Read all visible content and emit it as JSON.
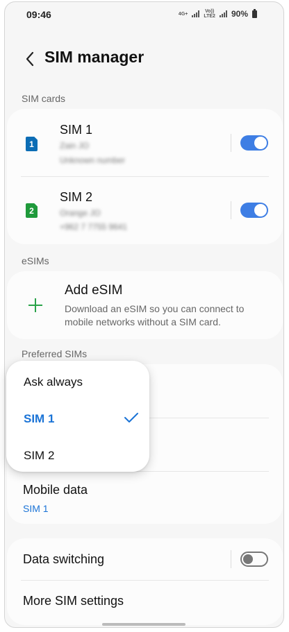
{
  "status_bar": {
    "time": "09:46",
    "network_1": "4G+",
    "network_2_top": "Vo))",
    "network_2_bottom": "LTE2",
    "battery": "90%"
  },
  "header": {
    "title": "SIM manager",
    "back_icon": "chevron-left-icon"
  },
  "sim_cards": {
    "section_label": "SIM cards",
    "items": [
      {
        "badge": "1",
        "name": "SIM 1",
        "line1": "Zain JO",
        "line2": "Unknown number",
        "enabled": true,
        "badge_color": "#0c6db5"
      },
      {
        "badge": "2",
        "name": "SIM 2",
        "line1": "Orange JO",
        "line2": "+962 7 7755 9641",
        "enabled": true,
        "badge_color": "#1f9a3b"
      }
    ]
  },
  "esims": {
    "section_label": "eSIMs",
    "add_title": "Add eSIM",
    "add_description_line1": "Download an eSIM so you can connect to",
    "add_description_line2": "mobile networks without a SIM card.",
    "add_icon": "plus-icon"
  },
  "preferred_sims": {
    "section_label": "Preferred SIMs",
    "mobile_data_title": "Mobile data",
    "mobile_data_value": "SIM 1"
  },
  "popup_menu": {
    "options": [
      {
        "label": "Ask always",
        "selected": false
      },
      {
        "label": "SIM 1",
        "selected": true
      },
      {
        "label": "SIM 2",
        "selected": false
      }
    ]
  },
  "other_settings": {
    "data_switching_label": "Data switching",
    "data_switching_enabled": false,
    "more_sim_settings_label": "More SIM settings"
  },
  "colors": {
    "accent": "#3e7ee4",
    "selected_text": "#1a73d6",
    "add_icon": "#2aa34a"
  }
}
